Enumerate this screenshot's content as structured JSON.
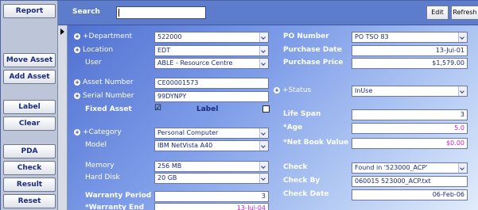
{
  "topbar": {
    "search_label": "Search",
    "search_value": "",
    "edit_label": "Edit",
    "refresh_label": "Refresh"
  },
  "leftcol": {
    "report": "Report",
    "move_asset": "Move Asset",
    "add_asset": "Add Asset",
    "label": "Label",
    "clear": "Clear",
    "pda": "PDA",
    "check": "Check",
    "result": "Result",
    "reset": "Reset"
  },
  "form": {
    "department_label": "+Department",
    "department_value": "522000",
    "location_label": "Location",
    "location_value": "EDT",
    "user_label": "User",
    "user_value": "ABLE - Resource Centre",
    "asset_number_label": "Asset Number",
    "asset_number_value": "CE00001573",
    "serial_number_label": "Serial Number",
    "serial_number_value": "99DYNPY",
    "fixed_asset_label": "Fixed Asset",
    "fixed_asset_checked": "☑",
    "label_check_label": "Label",
    "label_check_value": "",
    "category_label": "+Category",
    "category_value": "Personal Computer",
    "model_label": "Model",
    "model_value": "IBM NetVista A40",
    "memory_label": "Memory",
    "memory_value": "256 MB",
    "hard_disk_label": "Hard Disk",
    "hard_disk_value": "20 GB",
    "warranty_period_label": "Warranty Period",
    "warranty_period_value": "3",
    "warranty_end_label": "*Warranty End",
    "warranty_end_value": "13-Jul-04",
    "po_number_label": "PO Number",
    "po_number_value": "PO TSO 83",
    "purchase_date_label": "Purchase Date",
    "purchase_date_value": "13-Jul-01",
    "purchase_price_label": "Purchase Price",
    "purchase_price_value": "$1,579.00",
    "status_label": "+Status",
    "status_value": "InUse",
    "life_span_label": "Life Span",
    "life_span_value": "3",
    "age_label": "*Age",
    "age_value": "5.0",
    "nbv_label": "*Net Book Value",
    "nbv_value": "$0.00",
    "check_label": "Check",
    "check_value": "Found in '523000_ACP'",
    "check_by_label": "Check By",
    "check_by_value": "060015 523000_ACP.txt",
    "check_date_label": "Check Date",
    "check_date_value": "06-Feb-06"
  },
  "colors": {
    "accent": "#1a2a80",
    "panel": "#5d7ccc",
    "magenta": "#cc22cc"
  },
  "icons": {
    "selector": "record-selector-arrow",
    "plus": "plus-circle-icon",
    "dropdown": "chevron-down-icon"
  }
}
